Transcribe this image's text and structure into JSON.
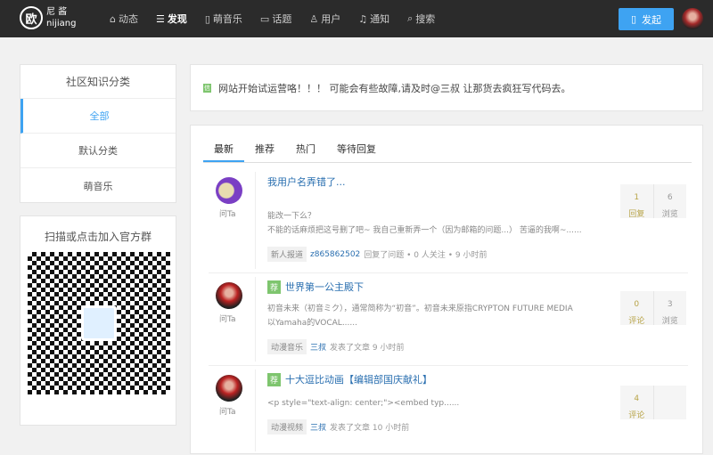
{
  "header": {
    "logo_char": "欧",
    "logo_cn": "尼 酱",
    "logo_en": "nijiang",
    "nav": [
      {
        "label": "动态",
        "icon": "home-icon"
      },
      {
        "label": "发现",
        "icon": "list-icon",
        "active": true
      },
      {
        "label": "萌音乐",
        "icon": "tablet-icon"
      },
      {
        "label": "话题",
        "icon": "chat-icon"
      },
      {
        "label": "用户",
        "icon": "user-icon"
      },
      {
        "label": "通知",
        "icon": "bell-icon"
      },
      {
        "label": "搜索",
        "icon": "search-icon"
      }
    ],
    "post_button": "发起"
  },
  "sidebar": {
    "category_title": "社区知识分类",
    "categories": [
      "全部",
      "默认分类",
      "萌音乐"
    ],
    "qr_title": "扫描或点击加入官方群"
  },
  "notice": {
    "icon": "信",
    "text": "网站开始试运营咯！！！ 可能会有些故障,请及时@三叔 让那货去疯狂写代码去。"
  },
  "tabs": [
    "最新",
    "推荐",
    "热门",
    "等待回复"
  ],
  "ask_label": "问Ta",
  "rec_label": "荐",
  "items": [
    {
      "title": "我用户名弄错了...",
      "lines": [
        "能改一下么？",
        "不能的话麻烦把这号删了吧~ 我自己重新弄一个（因为邮箱的问题...） 苦逼的我啊~......"
      ],
      "tag": "新人报道",
      "user": "z865862502",
      "action": "回复了问题 • 0 人关注 • 9 小时前",
      "stat1": "1",
      "stat1_label": "回复",
      "stat2": "6",
      "stat2_label": "浏览"
    },
    {
      "title": "世界第一公主殿下",
      "lines": [
        "初音未来（初音ミク），通常简称为“初音”。初音未来原指CRYPTON FUTURE MEDIA",
        "以Yamaha的VOCAL......"
      ],
      "tag": "动漫音乐",
      "user": "三叔",
      "action": "发表了文章 9 小时前",
      "stat1": "0",
      "stat1_label": "评论",
      "stat2": "3",
      "stat2_label": "浏览"
    },
    {
      "title": "十大逗比动画【编辑部国庆献礼】",
      "lines": [
        "<p style=\"text-align: center;\"><embed typ......"
      ],
      "tag": "动漫视频",
      "user": "三叔",
      "action": "发表了文章 10 小时前",
      "stat1": "4",
      "stat1_label": "评论"
    }
  ]
}
